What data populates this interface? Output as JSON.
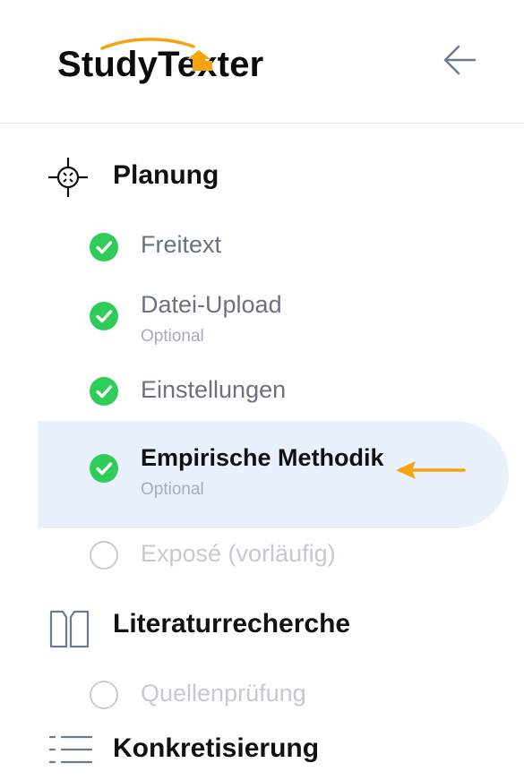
{
  "app": {
    "logo_text": "StudyTexter",
    "accent": "#f5a30f"
  },
  "sections": [
    {
      "title": "Planung",
      "icon": "crosshair-icon",
      "steps": [
        {
          "label": "Freitext",
          "status": "done"
        },
        {
          "label": "Datei-Upload",
          "sub": "Optional",
          "status": "done"
        },
        {
          "label": "Einstellungen",
          "status": "done"
        },
        {
          "label": "Empirische Methodik",
          "sub": "Optional",
          "status": "done-active"
        },
        {
          "label": "Exposé (vorläufig)",
          "status": "pending"
        }
      ]
    },
    {
      "title": "Literaturrecherche",
      "icon": "book-icon",
      "steps": [
        {
          "label": "Quellenprüfung",
          "status": "pending"
        }
      ]
    },
    {
      "title": "Konkretisierung",
      "icon": "list-icon",
      "steps": []
    }
  ],
  "colors": {
    "check_green": "#2ecc59",
    "active_bg": "#e8f1fd",
    "pending_circle": "#c4cad1"
  }
}
